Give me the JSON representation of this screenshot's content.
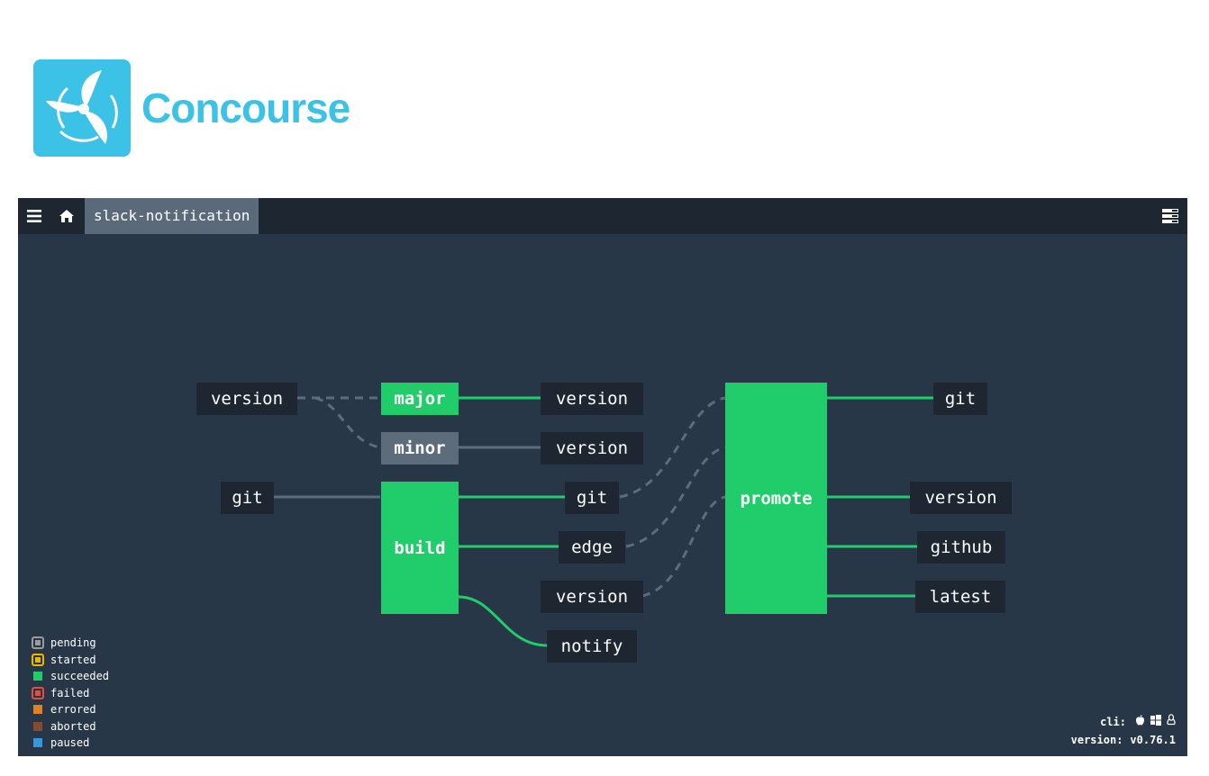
{
  "brand": {
    "name": "Concourse",
    "color": "#3bc2e6"
  },
  "topbar": {
    "menu_icon": "hamburger-icon",
    "home_icon": "home-icon",
    "pipeline_name": "slack-notification",
    "groups_icon": "groups-toggle-icon"
  },
  "pipeline": {
    "jobs": {
      "major": "major",
      "minor": "minor",
      "build": "build",
      "promote": "promote"
    },
    "resources": {
      "version_in": "version",
      "git_in": "git",
      "major_out": "version",
      "minor_out": "version",
      "build_git": "git",
      "build_edge": "edge",
      "version_mid": "version",
      "notify": "notify",
      "promote_git": "git",
      "promote_version": "version",
      "promote_github": "github",
      "promote_latest": "latest"
    }
  },
  "legend": [
    {
      "label": "pending",
      "color": "#9b9b9b",
      "ring": true
    },
    {
      "label": "started",
      "color": "#f0b400",
      "ring": true
    },
    {
      "label": "succeeded",
      "color": "#21cc6b",
      "ring": false
    },
    {
      "label": "failed",
      "color": "#e74c3c",
      "ring": true
    },
    {
      "label": "errored",
      "color": "#e67e22",
      "ring": false
    },
    {
      "label": "aborted",
      "color": "#8b4a2c",
      "ring": false
    },
    {
      "label": "paused",
      "color": "#3498db",
      "ring": false
    }
  ],
  "footer": {
    "cli_label": "cli:",
    "cli_icons": [
      "apple-icon",
      "windows-icon",
      "linux-icon"
    ],
    "version_label": "version:",
    "version_value": "v0.76.1"
  },
  "colors": {
    "background": "#273747",
    "topbar": "#1e2731",
    "succeeded": "#21cc6b",
    "inactive": "#5d6c7b"
  }
}
